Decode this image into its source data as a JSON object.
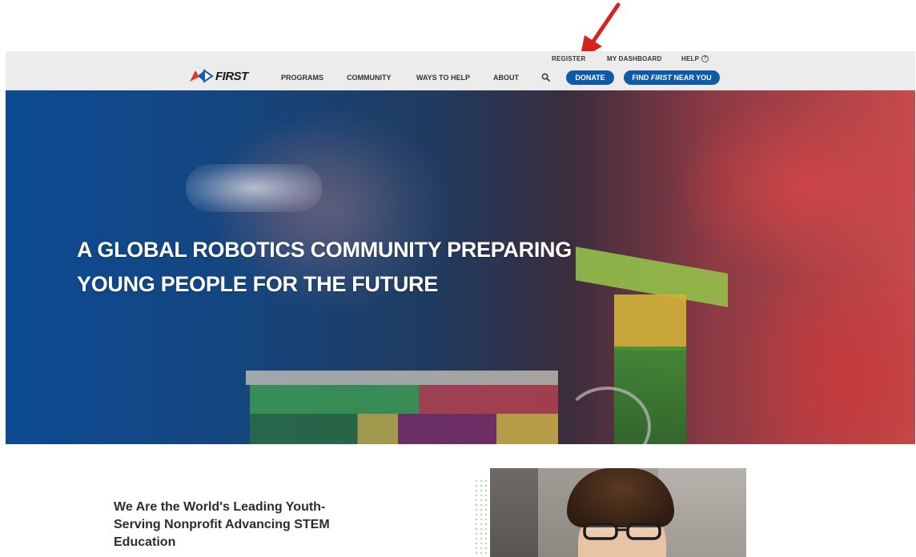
{
  "utility_nav": {
    "register": "REGISTER",
    "dashboard": "MY DASHBOARD",
    "help": "HELP"
  },
  "logo": {
    "text": "FIRST"
  },
  "main_nav": {
    "programs": "PROGRAMS",
    "community": "COMMUNITY",
    "ways_to_help": "WAYS TO HELP",
    "about": "ABOUT"
  },
  "buttons": {
    "donate": "DONATE",
    "find_prefix": "FIND ",
    "find_em": "FIRST",
    "find_suffix": " NEAR YOU"
  },
  "hero": {
    "title_line1": "A GLOBAL ROBOTICS COMMUNITY PREPARING",
    "title_line2": "YOUNG PEOPLE FOR THE FUTURE"
  },
  "intro": {
    "heading": "We Are the World's Leading Youth-Serving Nonprofit Advancing STEM Education"
  },
  "icons": {
    "search": "search-icon",
    "help": "help-icon",
    "annotation": "red-arrow-icon"
  },
  "colors": {
    "primary_button": "#0e5aa7",
    "header_bg": "#ececec",
    "annotation_red": "#d8231c"
  }
}
